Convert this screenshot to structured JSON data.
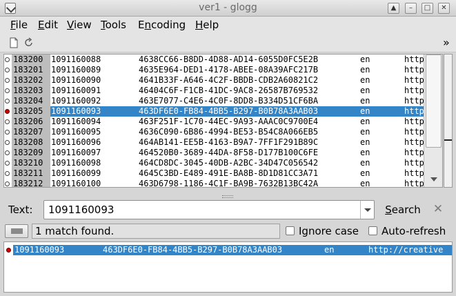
{
  "window": {
    "title": "ver1 - glogg",
    "buttons": [
      "▲",
      "–",
      "□",
      "✕"
    ]
  },
  "menu": [
    {
      "label": "File",
      "key": "F",
      "rest": "ile"
    },
    {
      "label": "Edit",
      "key": "E",
      "rest": "dit"
    },
    {
      "label": "View",
      "key": "V",
      "rest": "iew"
    },
    {
      "label": "Tools",
      "key": "T",
      "rest": "ools"
    },
    {
      "label": "Encoding",
      "key": "n",
      "pre": "E",
      "rest": "coding"
    },
    {
      "label": "Help",
      "key": "H",
      "rest": "elp"
    }
  ],
  "toolbar": {
    "overflow": "»"
  },
  "log": {
    "rows": [
      {
        "line": "183200",
        "id": "1091160088",
        "guid": "4638CC66-B8DD-4D88-AD14-6055D0FC5E2B",
        "lang": "en",
        "url": "http"
      },
      {
        "line": "183201",
        "id": "1091160089",
        "guid": "4635E964-DED1-4178-ABEE-08A39AFC217B",
        "lang": "en",
        "url": "http"
      },
      {
        "line": "183202",
        "id": "1091160090",
        "guid": "4641B33F-A646-4C2F-BBDB-CDB2A60821C2",
        "lang": "en",
        "url": "http"
      },
      {
        "line": "183203",
        "id": "1091160091",
        "guid": "46404C6F-F1CB-41DC-9AC8-26587B769532",
        "lang": "en",
        "url": "http"
      },
      {
        "line": "183204",
        "id": "1091160092",
        "guid": "463E7077-C4E6-4C0F-8DD8-B334D51CF6BA",
        "lang": "en",
        "url": "http"
      },
      {
        "line": "183205",
        "id": "1091160093",
        "guid": "463DF6E0-FB84-4BB5-B297-B0B78A3AAB03",
        "lang": "en",
        "url": "http",
        "selected": true
      },
      {
        "line": "183206",
        "id": "1091160094",
        "guid": "463F251F-1C70-44EC-9A93-AAAC0C9700E4",
        "lang": "en",
        "url": "http"
      },
      {
        "line": "183207",
        "id": "1091160095",
        "guid": "4636C090-6B86-4994-BE53-B54C8A066EB5",
        "lang": "en",
        "url": "http"
      },
      {
        "line": "183208",
        "id": "1091160096",
        "guid": "464AB141-EE5B-4163-B9A7-7FF1F291B89C",
        "lang": "en",
        "url": "http"
      },
      {
        "line": "183209",
        "id": "1091160097",
        "guid": "464520B0-3689-44DA-8F58-D177B100C6FE",
        "lang": "en",
        "url": "http"
      },
      {
        "line": "183210",
        "id": "1091160098",
        "guid": "464CD8DC-3045-40DB-A2BC-34D47C056542",
        "lang": "en",
        "url": "http"
      },
      {
        "line": "183211",
        "id": "1091160099",
        "guid": "4645C3BD-E489-491E-BA8B-8D1D81CC3A71",
        "lang": "en",
        "url": "http"
      },
      {
        "line": "183212",
        "id": "1091160100",
        "guid": "463D6798-1186-4C1F-BA9B-7632B13BC42A",
        "lang": "en",
        "url": "http"
      }
    ]
  },
  "search": {
    "label": "Text:",
    "value": "1091160093",
    "button": "Search",
    "clear": "✕",
    "status": "1 match found.",
    "ignore_case": "Ignore case",
    "auto_refresh": "Auto-refresh"
  },
  "filtered": {
    "rows": [
      {
        "id": "1091160093",
        "guid": "463DF6E0-FB84-4BB5-B297-B0B78A3AAB03",
        "lang": "en",
        "url": "http://creative"
      }
    ]
  },
  "colors": {
    "selection": "#3385c8",
    "match_marker": "#d00000"
  }
}
